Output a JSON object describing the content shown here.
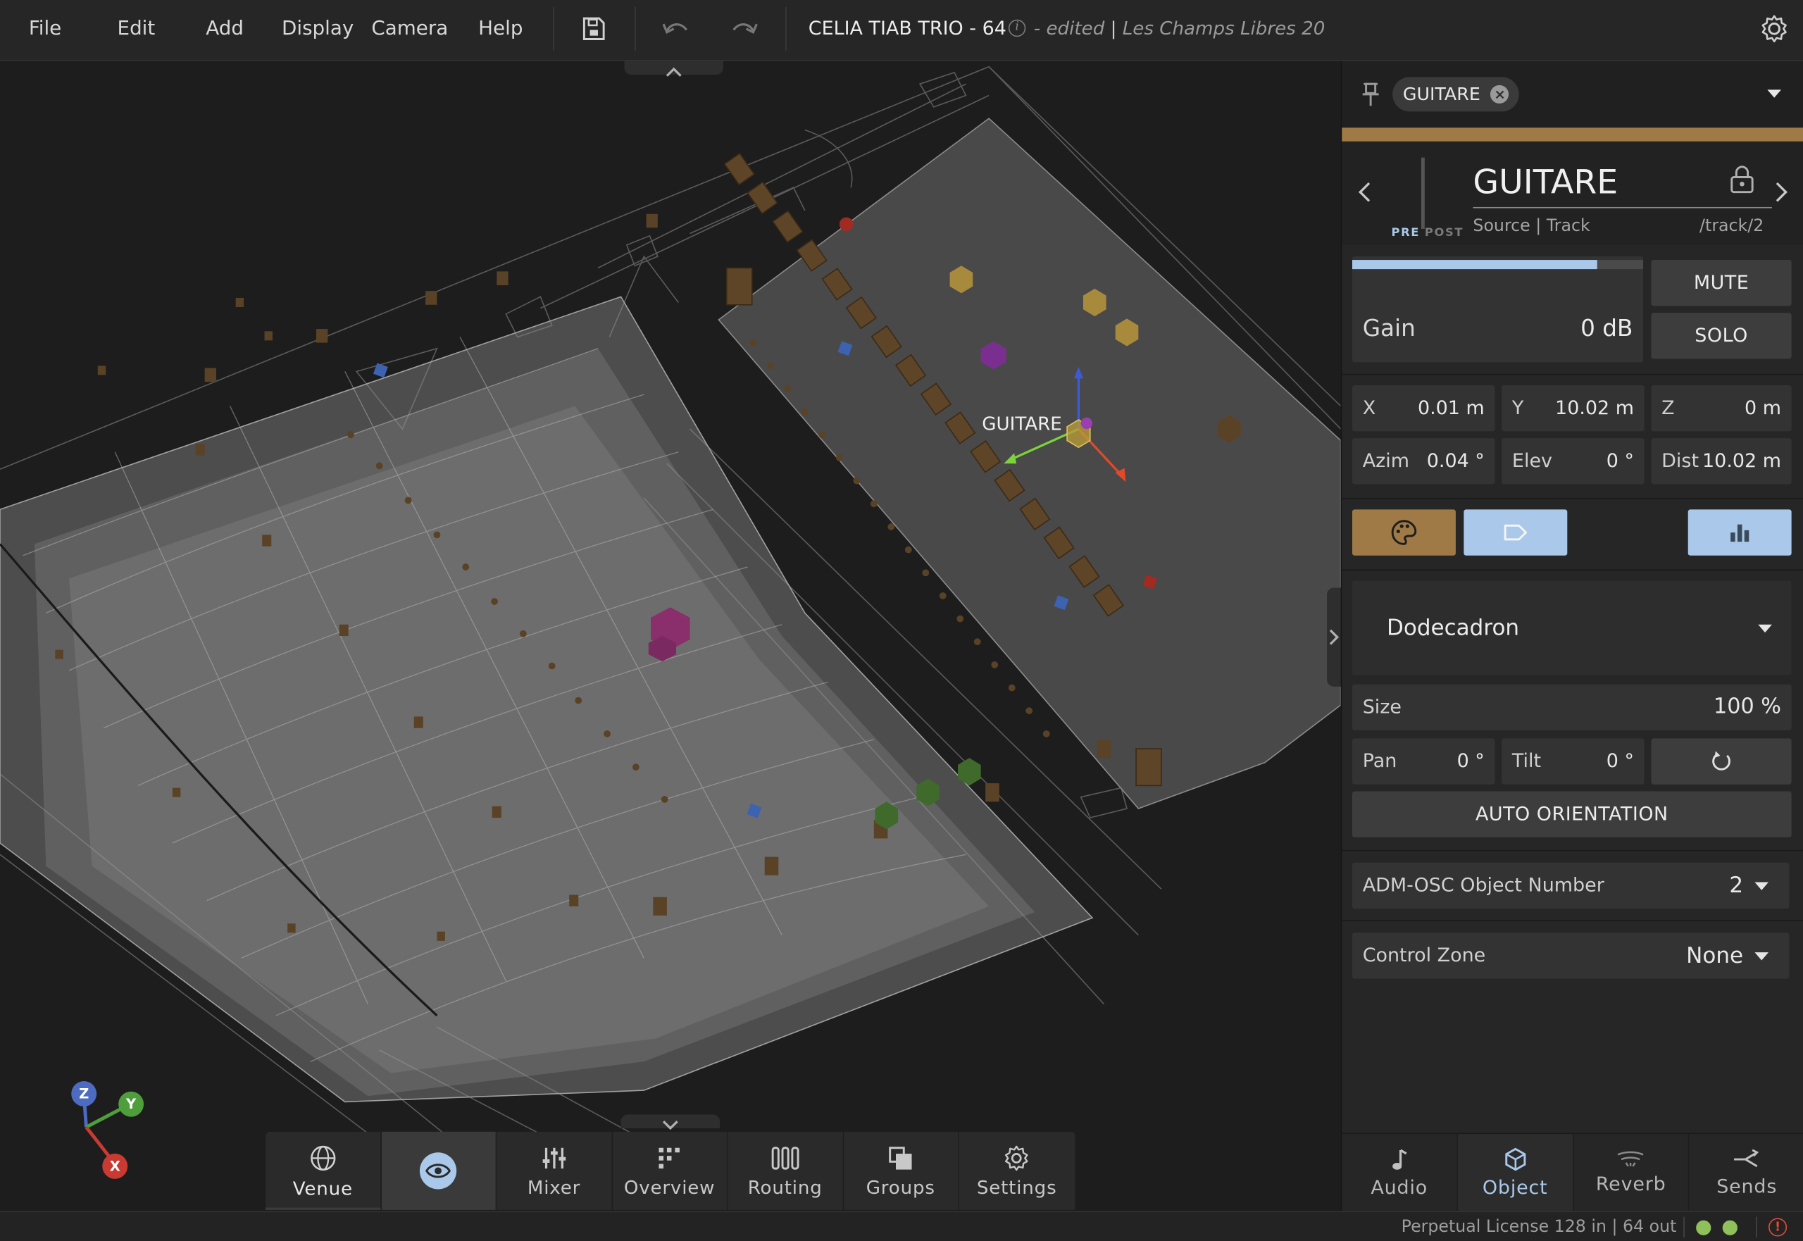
{
  "menubar": {
    "items": [
      "File",
      "Edit",
      "Add",
      "Display",
      "Camera",
      "Help"
    ],
    "project_title": "CELIA TIAB TRIO - 64",
    "edited_status": "- edited",
    "venue": "Les Champs Libres 20"
  },
  "viewport": {
    "selected_object_label": "GUITARE",
    "axes": [
      "Z",
      "Y",
      "X"
    ],
    "toolbar": [
      "Venue",
      "",
      "Mixer",
      "Overview",
      "Routing",
      "Groups",
      "Settings"
    ]
  },
  "panel": {
    "selector_chip": "GUITARE",
    "track_name": "GUITARE",
    "pre_label": "PRE",
    "post_label": "POST",
    "source_track": "Source | Track",
    "osc_path": "/track/2",
    "accent_color": "#9f7a47",
    "gain": {
      "label": "Gain",
      "value": "0 dB",
      "meter_level": 0.84
    },
    "mute_label": "MUTE",
    "solo_label": "SOLO",
    "position": {
      "x": {
        "label": "X",
        "value": "0.01 m"
      },
      "y": {
        "label": "Y",
        "value": "10.02 m"
      },
      "z": {
        "label": "Z",
        "value": "0 m"
      },
      "azim": {
        "label": "Azim",
        "value": "0.04 °"
      },
      "elev": {
        "label": "Elev",
        "value": "0 °"
      },
      "dist": {
        "label": "Dist",
        "value": "10.02 m"
      }
    },
    "shape": "Dodecadron",
    "size": {
      "label": "Size",
      "value": "100 %"
    },
    "pan": {
      "label": "Pan",
      "value": "0 °"
    },
    "tilt": {
      "label": "Tilt",
      "value": "0 °"
    },
    "auto_orientation_label": "AUTO ORIENTATION",
    "adm_osc": {
      "label": "ADM-OSC Object Number",
      "value": "2"
    },
    "control_zone": {
      "label": "Control Zone",
      "value": "None"
    },
    "tabs": [
      "Audio",
      "Object",
      "Reverb",
      "Sends"
    ],
    "active_tab": "Object"
  },
  "status": {
    "license": "Perpetual License 128 in | 64 out"
  }
}
